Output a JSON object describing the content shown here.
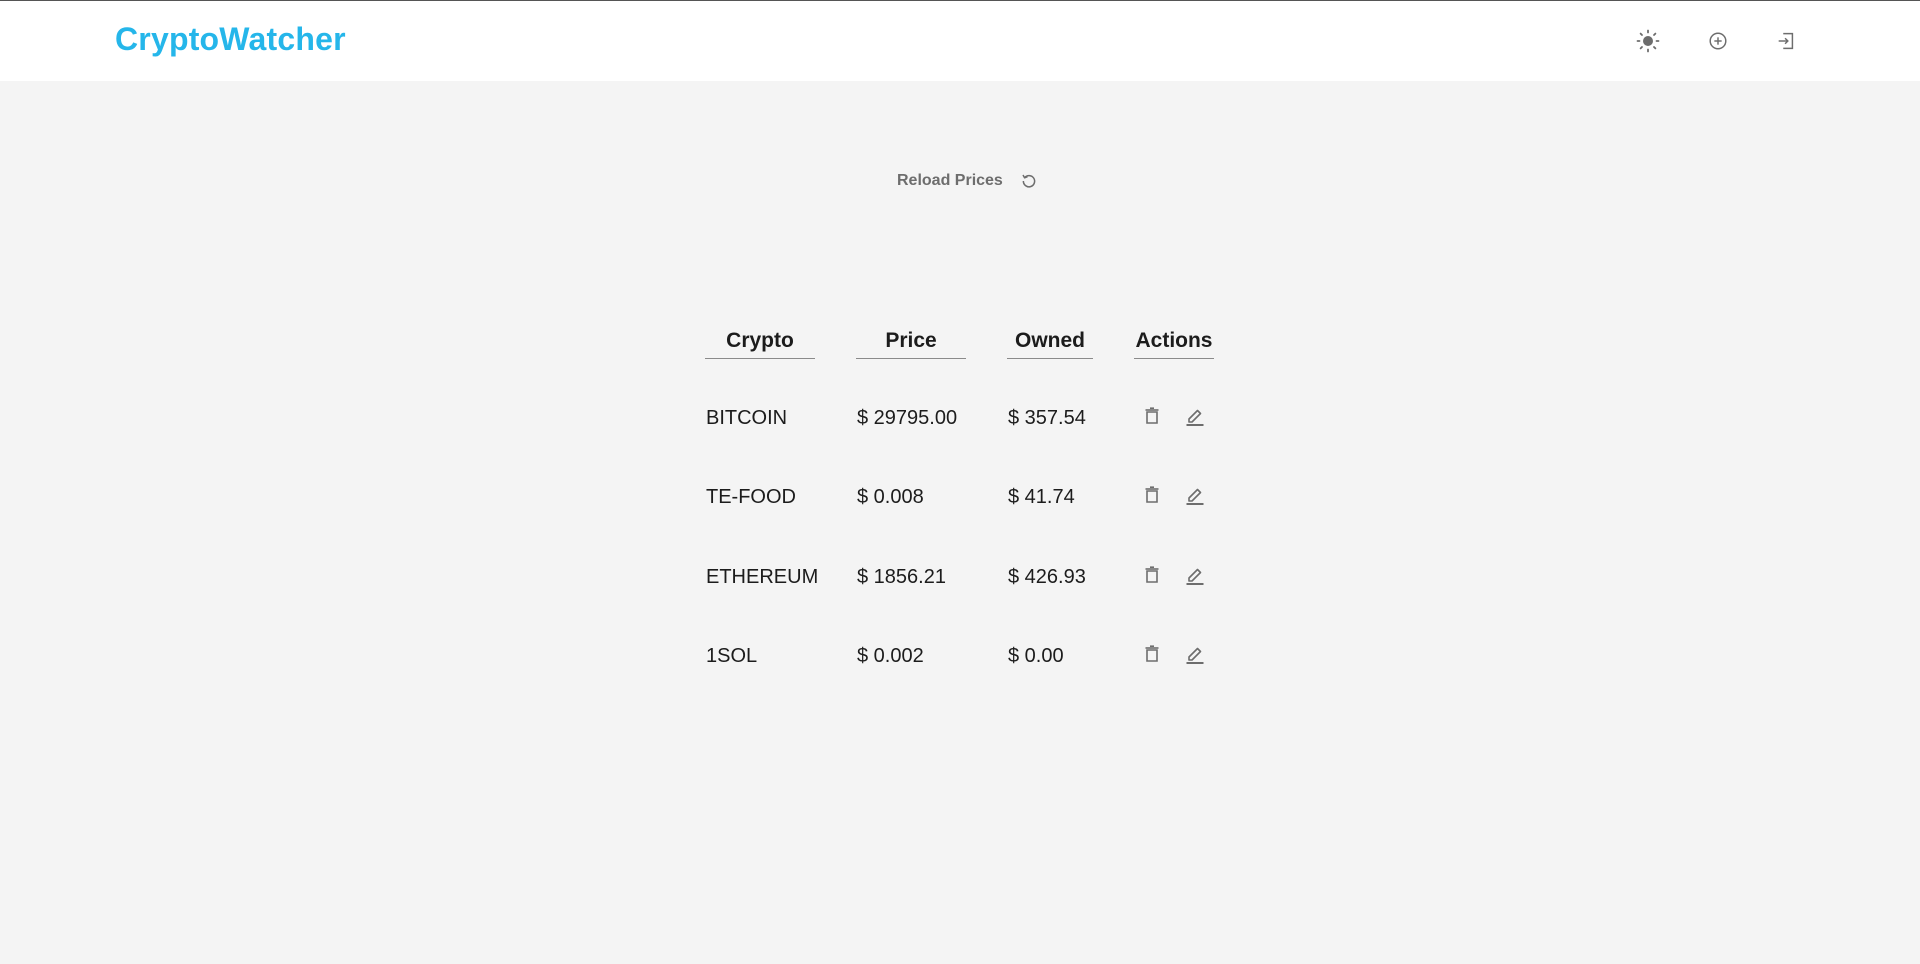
{
  "app": {
    "title": "CryptoWatcher"
  },
  "header": {
    "icons": [
      "sun-icon",
      "plus-circle-icon",
      "logout-icon"
    ]
  },
  "toolbar": {
    "reload_label": "Reload Prices",
    "reload_icon": "reload-icon"
  },
  "table": {
    "headers": {
      "crypto": "Crypto",
      "price": "Price",
      "owned": "Owned",
      "actions": "Actions"
    },
    "rows": [
      {
        "crypto": "BITCOIN",
        "price": "$ 29795.00",
        "owned": "$ 357.54"
      },
      {
        "crypto": "TE-FOOD",
        "price": "$ 0.008",
        "owned": "$ 41.74"
      },
      {
        "crypto": "ETHEREUM",
        "price": "$ 1856.21",
        "owned": "$ 426.93"
      },
      {
        "crypto": "1SOL",
        "price": "$ 0.002",
        "owned": "$ 0.00"
      }
    ],
    "row_actions": [
      "delete-icon",
      "edit-icon"
    ]
  },
  "colors": {
    "brand": "#25b6ea",
    "icon": "#6d6d6d",
    "background": "#f4f4f4",
    "header": "#ffffff"
  }
}
